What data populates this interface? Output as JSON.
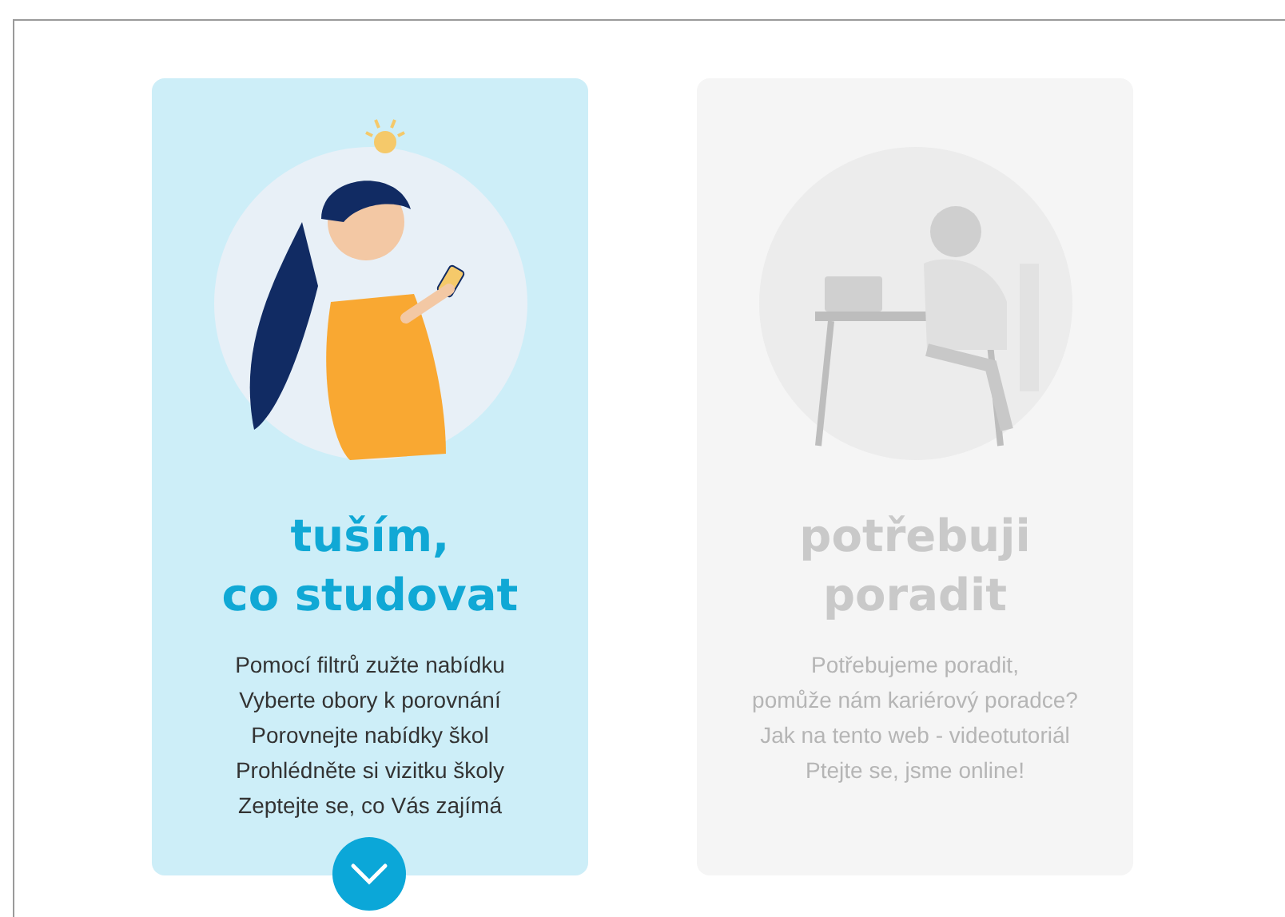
{
  "cards": [
    {
      "kind": "phone",
      "selected": true,
      "title_lines": [
        "tuším,",
        "co studovat"
      ],
      "items": [
        "Pomocí filtrů zužte nabídku",
        "Vyberte obory k porovnání",
        "Porovnejte nabídky škol",
        "Prohlédněte si vizitku školy",
        "Zeptejte se, co Vás zajímá"
      ]
    },
    {
      "kind": "desk",
      "selected": false,
      "title_lines": [
        "potřebuji",
        "poradit"
      ],
      "items": [
        "Potřebujeme poradit,",
        "pomůže nám kariérový poradce?",
        "Jak na tento web - videotutoriál",
        "Ptejte se, jsme online!"
      ]
    }
  ]
}
